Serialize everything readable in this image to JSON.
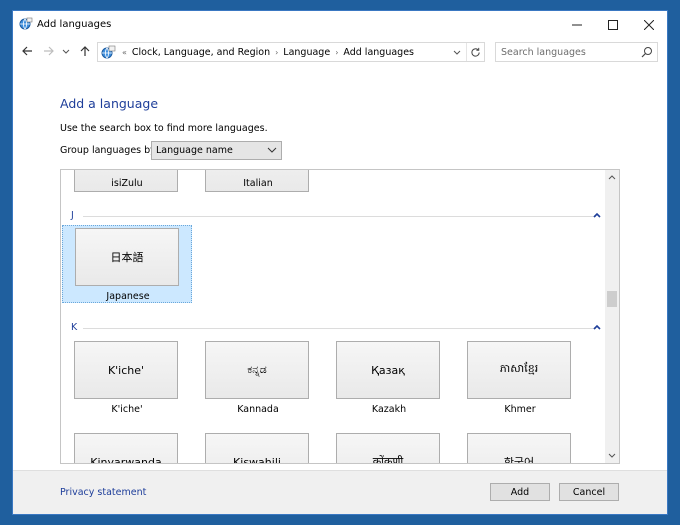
{
  "window": {
    "title": "Add languages",
    "controls": {
      "minimize": "minimize-icon",
      "maximize": "maximize-icon",
      "close": "close-icon"
    }
  },
  "nav": {
    "back": "back-arrow-icon",
    "forward": "forward-arrow-icon",
    "recent": "chevron-down-icon",
    "up": "up-arrow-icon",
    "breadcrumb_prefix": "«",
    "breadcrumbs": [
      "Clock, Language, and Region",
      "Language",
      "Add languages"
    ],
    "search_placeholder": "Search languages"
  },
  "content": {
    "heading": "Add a language",
    "hint": "Use the search box to find more languages.",
    "group_label": "Group languages by:",
    "group_value": "Language name"
  },
  "list": {
    "top_partial": [
      {
        "name": "isiZulu"
      },
      {
        "name": "Italian"
      }
    ],
    "sections": [
      {
        "letter": "J",
        "tiles": [
          {
            "script": "日本語",
            "name": "Japanese",
            "selected": true
          }
        ]
      },
      {
        "letter": "K",
        "tiles": [
          {
            "script": "K'iche'",
            "name": "K'iche'"
          },
          {
            "script": "ಕನ್ನಡ",
            "name": "Kannada"
          },
          {
            "script": "Қазақ",
            "name": "Kazakh"
          },
          {
            "script": "ភាសាខ្មែរ",
            "name": "Khmer"
          }
        ],
        "partial_tiles": [
          {
            "script": "",
            "name": "Kinyarwanda"
          },
          {
            "script": "",
            "name": "Kiswahili"
          },
          {
            "script": "कोंकणी",
            "name": ""
          },
          {
            "script": "한국어",
            "name": ""
          }
        ]
      }
    ]
  },
  "footer": {
    "privacy": "Privacy statement",
    "add": "Add",
    "cancel": "Cancel"
  },
  "colors": {
    "accent": "#1e3e9a",
    "selection": "#cce8ff",
    "desktop": "#1f5f9e"
  }
}
